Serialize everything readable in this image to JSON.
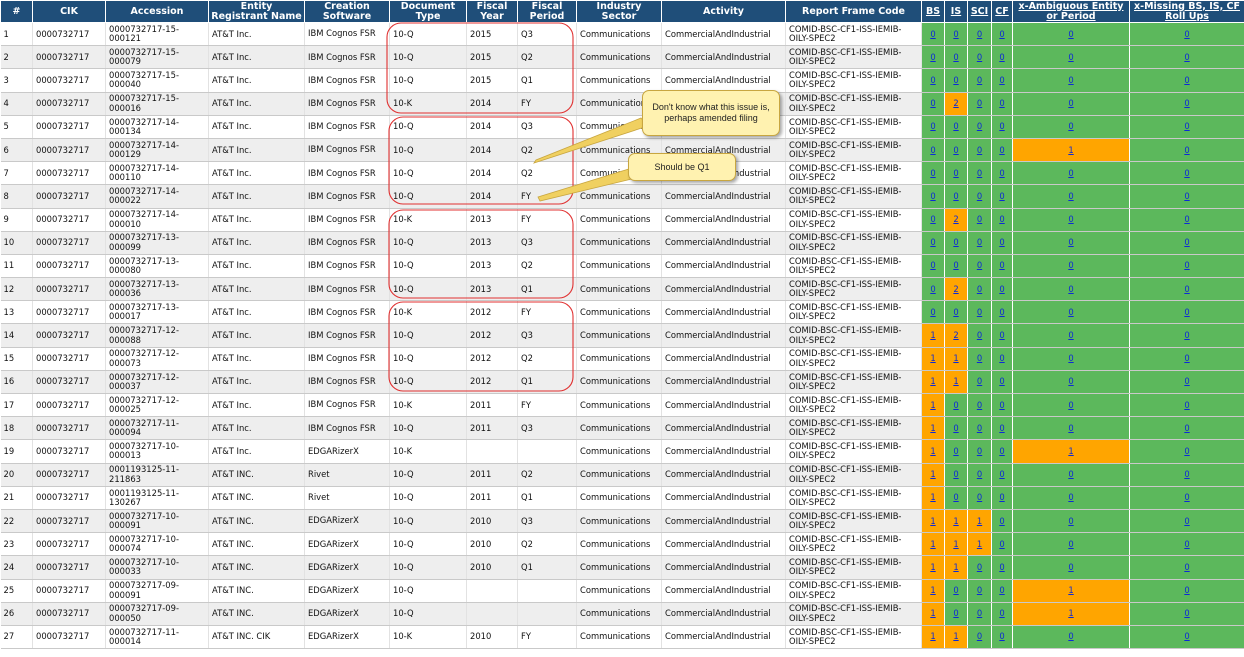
{
  "headers": {
    "num": "#",
    "cik": "CIK",
    "accession": "Accession",
    "registrant": "Entity Registrant Name",
    "software": "Creation Software",
    "doctype": "Document Type",
    "year": "Fiscal Year",
    "period": "Fiscal Period",
    "sector": "Industry Sector",
    "activity": "Activity",
    "rfc": "Report Frame Code",
    "bs": "BS",
    "is": "IS",
    "sci": "SCI",
    "cf": "CF",
    "ambiguous": "x-Ambiguous Entity or Period",
    "missing": "x-Missing BS, IS, CF Roll Ups"
  },
  "colors": {
    "header": "#1f4e79",
    "ok": "#5cb85c",
    "warn": "#ffa500",
    "annotation_outline": "#e03030",
    "callout_fill": "#fff2b0"
  },
  "callouts": [
    {
      "text": "Don't know what this issue is, perhaps amended filing"
    },
    {
      "text": "Should be Q1"
    }
  ],
  "rows": [
    {
      "n": "1",
      "cik": "0000732717",
      "acc": "0000732717-15-000121",
      "name": "AT&T Inc.",
      "sw": "IBM Cognos FSR",
      "doc": "10-Q",
      "fy": "2015",
      "fp": "Q3",
      "sector": "Communications",
      "act": "CommercialAndIndustrial",
      "rfc": "COMID-BSC-CF1-ISS-IEMIB-OILY-SPEC2",
      "bs": "0",
      "is": "0",
      "sci": "0",
      "cf": "0",
      "amb": "0",
      "miss": "0"
    },
    {
      "n": "2",
      "cik": "0000732717",
      "acc": "0000732717-15-000079",
      "name": "AT&T Inc.",
      "sw": "IBM Cognos FSR",
      "doc": "10-Q",
      "fy": "2015",
      "fp": "Q2",
      "sector": "Communications",
      "act": "CommercialAndIndustrial",
      "rfc": "COMID-BSC-CF1-ISS-IEMIB-OILY-SPEC2",
      "bs": "0",
      "is": "0",
      "sci": "0",
      "cf": "0",
      "amb": "0",
      "miss": "0"
    },
    {
      "n": "3",
      "cik": "0000732717",
      "acc": "0000732717-15-000040",
      "name": "AT&T Inc.",
      "sw": "IBM Cognos FSR",
      "doc": "10-Q",
      "fy": "2015",
      "fp": "Q1",
      "sector": "Communications",
      "act": "CommercialAndIndustrial",
      "rfc": "COMID-BSC-CF1-ISS-IEMIB-OILY-SPEC2",
      "bs": "0",
      "is": "0",
      "sci": "0",
      "cf": "0",
      "amb": "0",
      "miss": "0"
    },
    {
      "n": "4",
      "cik": "0000732717",
      "acc": "0000732717-15-000016",
      "name": "AT&T Inc.",
      "sw": "IBM Cognos FSR",
      "doc": "10-K",
      "fy": "2014",
      "fp": "FY",
      "sector": "Communications",
      "act": "",
      "rfc": "COMID-BSC-CF1-ISS-IEMIB-OILY-SPEC2",
      "bs": "0",
      "is": "2",
      "sci": "0",
      "cf": "0",
      "amb": "0",
      "miss": "0"
    },
    {
      "n": "5",
      "cik": "0000732717",
      "acc": "0000732717-14-000134",
      "name": "AT&T Inc.",
      "sw": "IBM Cognos FSR",
      "doc": "10-Q",
      "fy": "2014",
      "fp": "Q3",
      "sector": "Communications",
      "act": "",
      "rfc": "COMID-BSC-CF1-ISS-IEMIB-OILY-SPEC2",
      "bs": "0",
      "is": "0",
      "sci": "0",
      "cf": "0",
      "amb": "0",
      "miss": "0"
    },
    {
      "n": "6",
      "cik": "0000732717",
      "acc": "0000732717-14-000129",
      "name": "AT&T Inc.",
      "sw": "IBM Cognos FSR",
      "doc": "10-Q",
      "fy": "2014",
      "fp": "Q2",
      "sector": "Communications",
      "act": "CommercialAndIndustrial",
      "rfc": "COMID-BSC-CF1-ISS-IEMIB-OILY-SPEC2",
      "bs": "0",
      "is": "0",
      "sci": "0",
      "cf": "0",
      "amb": "1",
      "miss": "0"
    },
    {
      "n": "7",
      "cik": "0000732717",
      "acc": "0000732717-14-000110",
      "name": "AT&T Inc.",
      "sw": "IBM Cognos FSR",
      "doc": "10-Q",
      "fy": "2014",
      "fp": "Q2",
      "sector": "Communications",
      "act": "CommercialAndIndustrial",
      "rfc": "COMID-BSC-CF1-ISS-IEMIB-OILY-SPEC2",
      "bs": "0",
      "is": "0",
      "sci": "0",
      "cf": "0",
      "amb": "0",
      "miss": "0"
    },
    {
      "n": "8",
      "cik": "0000732717",
      "acc": "0000732717-14-000022",
      "name": "AT&T Inc.",
      "sw": "IBM Cognos FSR",
      "doc": "10-Q",
      "fy": "2014",
      "fp": "FY",
      "sector": "Communications",
      "act": "CommercialAndIndustrial",
      "rfc": "COMID-BSC-CF1-ISS-IEMIB-OILY-SPEC2",
      "bs": "0",
      "is": "0",
      "sci": "0",
      "cf": "0",
      "amb": "0",
      "miss": "0"
    },
    {
      "n": "9",
      "cik": "0000732717",
      "acc": "0000732717-14-000010",
      "name": "AT&T Inc.",
      "sw": "IBM Cognos FSR",
      "doc": "10-K",
      "fy": "2013",
      "fp": "FY",
      "sector": "Communications",
      "act": "CommercialAndIndustrial",
      "rfc": "COMID-BSC-CF1-ISS-IEMIB-OILY-SPEC2",
      "bs": "0",
      "is": "2",
      "sci": "0",
      "cf": "0",
      "amb": "0",
      "miss": "0"
    },
    {
      "n": "10",
      "cik": "0000732717",
      "acc": "0000732717-13-000099",
      "name": "AT&T Inc.",
      "sw": "IBM Cognos FSR",
      "doc": "10-Q",
      "fy": "2013",
      "fp": "Q3",
      "sector": "Communications",
      "act": "CommercialAndIndustrial",
      "rfc": "COMID-BSC-CF1-ISS-IEMIB-OILY-SPEC2",
      "bs": "0",
      "is": "0",
      "sci": "0",
      "cf": "0",
      "amb": "0",
      "miss": "0"
    },
    {
      "n": "11",
      "cik": "0000732717",
      "acc": "0000732717-13-000080",
      "name": "AT&T Inc.",
      "sw": "IBM Cognos FSR",
      "doc": "10-Q",
      "fy": "2013",
      "fp": "Q2",
      "sector": "Communications",
      "act": "CommercialAndIndustrial",
      "rfc": "COMID-BSC-CF1-ISS-IEMIB-OILY-SPEC2",
      "bs": "0",
      "is": "0",
      "sci": "0",
      "cf": "0",
      "amb": "0",
      "miss": "0"
    },
    {
      "n": "12",
      "cik": "0000732717",
      "acc": "0000732717-13-000036",
      "name": "AT&T Inc.",
      "sw": "IBM Cognos FSR",
      "doc": "10-Q",
      "fy": "2013",
      "fp": "Q1",
      "sector": "Communications",
      "act": "CommercialAndIndustrial",
      "rfc": "COMID-BSC-CF1-ISS-IEMIB-OILY-SPEC2",
      "bs": "0",
      "is": "2",
      "sci": "0",
      "cf": "0",
      "amb": "0",
      "miss": "0"
    },
    {
      "n": "13",
      "cik": "0000732717",
      "acc": "0000732717-13-000017",
      "name": "AT&T Inc.",
      "sw": "IBM Cognos FSR",
      "doc": "10-K",
      "fy": "2012",
      "fp": "FY",
      "sector": "Communications",
      "act": "CommercialAndIndustrial",
      "rfc": "COMID-BSC-CF1-ISS-IEMIB-OILY-SPEC2",
      "bs": "0",
      "is": "0",
      "sci": "0",
      "cf": "0",
      "amb": "0",
      "miss": "0"
    },
    {
      "n": "14",
      "cik": "0000732717",
      "acc": "0000732717-12-000088",
      "name": "AT&T Inc.",
      "sw": "IBM Cognos FSR",
      "doc": "10-Q",
      "fy": "2012",
      "fp": "Q3",
      "sector": "Communications",
      "act": "CommercialAndIndustrial",
      "rfc": "COMID-BSC-CF1-ISS-IEMIB-OILY-SPEC2",
      "bs": "1",
      "is": "2",
      "sci": "0",
      "cf": "0",
      "amb": "0",
      "miss": "0"
    },
    {
      "n": "15",
      "cik": "0000732717",
      "acc": "0000732717-12-000073",
      "name": "AT&T Inc.",
      "sw": "IBM Cognos FSR",
      "doc": "10-Q",
      "fy": "2012",
      "fp": "Q2",
      "sector": "Communications",
      "act": "CommercialAndIndustrial",
      "rfc": "COMID-BSC-CF1-ISS-IEMIB-OILY-SPEC2",
      "bs": "1",
      "is": "1",
      "sci": "0",
      "cf": "0",
      "amb": "0",
      "miss": "0"
    },
    {
      "n": "16",
      "cik": "0000732717",
      "acc": "0000732717-12-000037",
      "name": "AT&T Inc.",
      "sw": "IBM Cognos FSR",
      "doc": "10-Q",
      "fy": "2012",
      "fp": "Q1",
      "sector": "Communications",
      "act": "CommercialAndIndustrial",
      "rfc": "COMID-BSC-CF1-ISS-IEMIB-OILY-SPEC2",
      "bs": "1",
      "is": "1",
      "sci": "0",
      "cf": "0",
      "amb": "0",
      "miss": "0"
    },
    {
      "n": "17",
      "cik": "0000732717",
      "acc": "0000732717-12-000025",
      "name": "AT&T Inc.",
      "sw": "IBM Cognos FSR",
      "doc": "10-K",
      "fy": "2011",
      "fp": "FY",
      "sector": "Communications",
      "act": "CommercialAndIndustrial",
      "rfc": "COMID-BSC-CF1-ISS-IEMIB-OILY-SPEC2",
      "bs": "1",
      "is": "0",
      "sci": "0",
      "cf": "0",
      "amb": "0",
      "miss": "0"
    },
    {
      "n": "18",
      "cik": "0000732717",
      "acc": "0000732717-11-000094",
      "name": "AT&T Inc.",
      "sw": "IBM Cognos FSR",
      "doc": "10-Q",
      "fy": "2011",
      "fp": "Q3",
      "sector": "Communications",
      "act": "CommercialAndIndustrial",
      "rfc": "COMID-BSC-CF1-ISS-IEMIB-OILY-SPEC2",
      "bs": "1",
      "is": "0",
      "sci": "0",
      "cf": "0",
      "amb": "0",
      "miss": "0"
    },
    {
      "n": "19",
      "cik": "0000732717",
      "acc": "0000732717-10-000013",
      "name": "AT&T Inc.",
      "sw": "EDGARizerX",
      "doc": "10-K",
      "fy": "",
      "fp": "",
      "sector": "Communications",
      "act": "CommercialAndIndustrial",
      "rfc": "COMID-BSC-CF1-ISS-IEMIB-OILY-SPEC2",
      "bs": "1",
      "is": "0",
      "sci": "0",
      "cf": "0",
      "amb": "1",
      "miss": "0"
    },
    {
      "n": "20",
      "cik": "0000732717",
      "acc": "0001193125-11-211863",
      "name": "AT&T INC.",
      "sw": "Rivet",
      "doc": "10-Q",
      "fy": "2011",
      "fp": "Q2",
      "sector": "Communications",
      "act": "CommercialAndIndustrial",
      "rfc": "COMID-BSC-CF1-ISS-IEMIB-OILY-SPEC2",
      "bs": "1",
      "is": "0",
      "sci": "0",
      "cf": "0",
      "amb": "0",
      "miss": "0"
    },
    {
      "n": "21",
      "cik": "0000732717",
      "acc": "0001193125-11-130267",
      "name": "AT&T INC.",
      "sw": "Rivet",
      "doc": "10-Q",
      "fy": "2011",
      "fp": "Q1",
      "sector": "Communications",
      "act": "CommercialAndIndustrial",
      "rfc": "COMID-BSC-CF1-ISS-IEMIB-OILY-SPEC2",
      "bs": "1",
      "is": "0",
      "sci": "0",
      "cf": "0",
      "amb": "0",
      "miss": "0"
    },
    {
      "n": "22",
      "cik": "0000732717",
      "acc": "0000732717-10-000091",
      "name": "AT&T INC.",
      "sw": "EDGARizerX",
      "doc": "10-Q",
      "fy": "2010",
      "fp": "Q3",
      "sector": "Communications",
      "act": "CommercialAndIndustrial",
      "rfc": "COMID-BSC-CF1-ISS-IEMIB-OILY-SPEC2",
      "bs": "1",
      "is": "1",
      "sci": "1",
      "cf": "0",
      "amb": "0",
      "miss": "0"
    },
    {
      "n": "23",
      "cik": "0000732717",
      "acc": "0000732717-10-000074",
      "name": "AT&T INC.",
      "sw": "EDGARizerX",
      "doc": "10-Q",
      "fy": "2010",
      "fp": "Q2",
      "sector": "Communications",
      "act": "CommercialAndIndustrial",
      "rfc": "COMID-BSC-CF1-ISS-IEMIB-OILY-SPEC2",
      "bs": "1",
      "is": "1",
      "sci": "1",
      "cf": "0",
      "amb": "0",
      "miss": "0"
    },
    {
      "n": "24",
      "cik": "0000732717",
      "acc": "0000732717-10-000033",
      "name": "AT&T INC.",
      "sw": "EDGARizerX",
      "doc": "10-Q",
      "fy": "2010",
      "fp": "Q1",
      "sector": "Communications",
      "act": "CommercialAndIndustrial",
      "rfc": "COMID-BSC-CF1-ISS-IEMIB-OILY-SPEC2",
      "bs": "1",
      "is": "1",
      "sci": "0",
      "cf": "0",
      "amb": "0",
      "miss": "0"
    },
    {
      "n": "25",
      "cik": "0000732717",
      "acc": "0000732717-09-000091",
      "name": "AT&T INC.",
      "sw": "EDGARizerX",
      "doc": "10-Q",
      "fy": "",
      "fp": "",
      "sector": "Communications",
      "act": "CommercialAndIndustrial",
      "rfc": "COMID-BSC-CF1-ISS-IEMIB-OILY-SPEC2",
      "bs": "1",
      "is": "0",
      "sci": "0",
      "cf": "0",
      "amb": "1",
      "miss": "0"
    },
    {
      "n": "26",
      "cik": "0000732717",
      "acc": "0000732717-09-000050",
      "name": "AT&T INC.",
      "sw": "EDGARizerX",
      "doc": "10-Q",
      "fy": "",
      "fp": "",
      "sector": "Communications",
      "act": "CommercialAndIndustrial",
      "rfc": "COMID-BSC-CF1-ISS-IEMIB-OILY-SPEC2",
      "bs": "1",
      "is": "0",
      "sci": "0",
      "cf": "0",
      "amb": "1",
      "miss": "0"
    },
    {
      "n": "27",
      "cik": "0000732717",
      "acc": "0000732717-11-000014",
      "name": "AT&T INC. CIK",
      "sw": "EDGARizerX",
      "doc": "10-K",
      "fy": "2010",
      "fp": "FY",
      "sector": "Communications",
      "act": "CommercialAndIndustrial",
      "rfc": "COMID-BSC-CF1-ISS-IEMIB-OILY-SPEC2",
      "bs": "1",
      "is": "1",
      "sci": "0",
      "cf": "0",
      "amb": "0",
      "miss": "0"
    }
  ]
}
